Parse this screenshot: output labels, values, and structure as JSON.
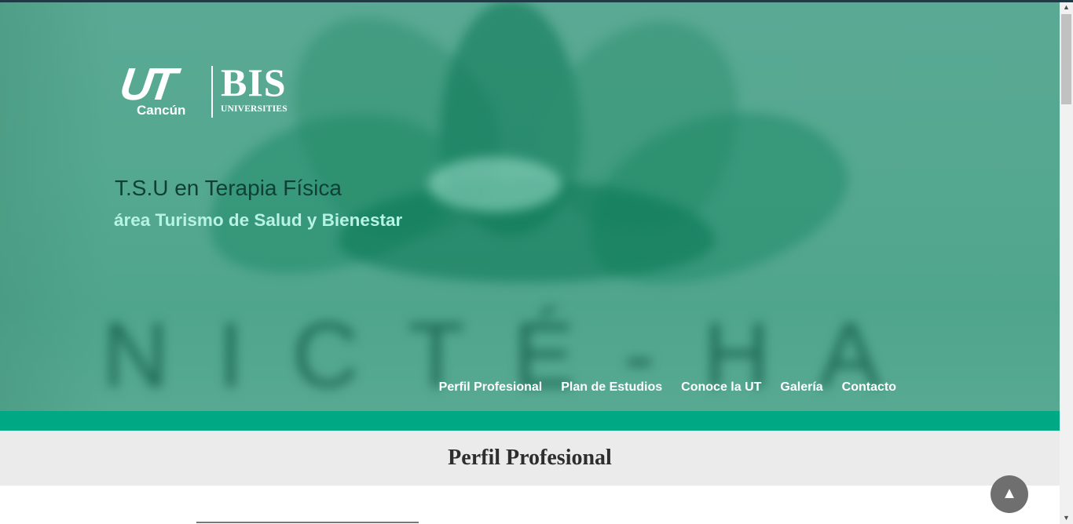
{
  "brand": {
    "ut_mark": "UT",
    "ut_city": "Cancún",
    "bis_mark": "BIS",
    "bis_sub": "UNIVERSITIES"
  },
  "hero": {
    "title": "T.S.U en Terapia Física",
    "subtitle": "área Turismo de Salud y Bienestar",
    "background_word": "NICTÉ-HA"
  },
  "nav": {
    "items": [
      {
        "label": "Perfil Profesional"
      },
      {
        "label": "Plan de Estudios"
      },
      {
        "label": "Conoce la UT"
      },
      {
        "label": "Galería"
      },
      {
        "label": "Contacto"
      }
    ]
  },
  "section": {
    "title": "Perfil Profesional"
  },
  "scroll_top": {
    "icon": "arrow-up-icon",
    "glyph": "▲"
  },
  "colors": {
    "accent_bar": "#00a884",
    "hero_tint": "#55a890",
    "section_bg": "#ebebeb",
    "subtitle": "#b7f3e3"
  }
}
